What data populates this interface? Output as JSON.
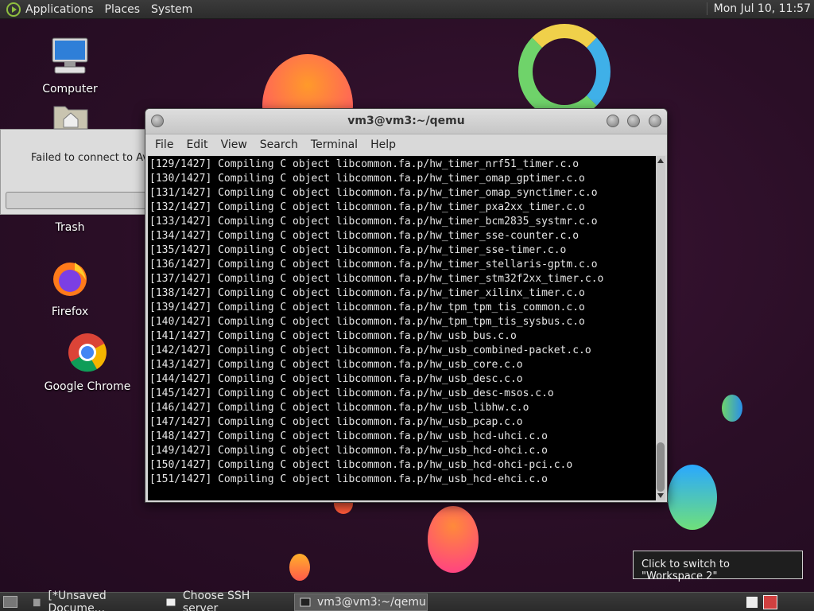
{
  "top_panel": {
    "menus": [
      "Applications",
      "Places",
      "System"
    ],
    "clock": "Mon Jul 10, 11:57"
  },
  "desktop_icons": [
    {
      "label": "Computer"
    },
    {
      "label": "Trash"
    },
    {
      "label": "Firefox"
    },
    {
      "label": "Google Chrome"
    }
  ],
  "failed_dialog": {
    "message": "Failed to connect to Ava"
  },
  "terminal": {
    "title": "vm3@vm3:~/qemu",
    "menu": [
      "File",
      "Edit",
      "View",
      "Search",
      "Terminal",
      "Help"
    ],
    "lines": [
      "[129/1427] Compiling C object libcommon.fa.p/hw_timer_nrf51_timer.c.o",
      "[130/1427] Compiling C object libcommon.fa.p/hw_timer_omap_gptimer.c.o",
      "[131/1427] Compiling C object libcommon.fa.p/hw_timer_omap_synctimer.c.o",
      "[132/1427] Compiling C object libcommon.fa.p/hw_timer_pxa2xx_timer.c.o",
      "[133/1427] Compiling C object libcommon.fa.p/hw_timer_bcm2835_systmr.c.o",
      "[134/1427] Compiling C object libcommon.fa.p/hw_timer_sse-counter.c.o",
      "[135/1427] Compiling C object libcommon.fa.p/hw_timer_sse-timer.c.o",
      "[136/1427] Compiling C object libcommon.fa.p/hw_timer_stellaris-gptm.c.o",
      "[137/1427] Compiling C object libcommon.fa.p/hw_timer_stm32f2xx_timer.c.o",
      "[138/1427] Compiling C object libcommon.fa.p/hw_timer_xilinx_timer.c.o",
      "[139/1427] Compiling C object libcommon.fa.p/hw_tpm_tpm_tis_common.c.o",
      "[140/1427] Compiling C object libcommon.fa.p/hw_tpm_tpm_tis_sysbus.c.o",
      "[141/1427] Compiling C object libcommon.fa.p/hw_usb_bus.c.o",
      "[142/1427] Compiling C object libcommon.fa.p/hw_usb_combined-packet.c.o",
      "[143/1427] Compiling C object libcommon.fa.p/hw_usb_core.c.o",
      "[144/1427] Compiling C object libcommon.fa.p/hw_usb_desc.c.o",
      "[145/1427] Compiling C object libcommon.fa.p/hw_usb_desc-msos.c.o",
      "[146/1427] Compiling C object libcommon.fa.p/hw_usb_libhw.c.o",
      "[147/1427] Compiling C object libcommon.fa.p/hw_usb_pcap.c.o",
      "[148/1427] Compiling C object libcommon.fa.p/hw_usb_hcd-uhci.c.o",
      "[149/1427] Compiling C object libcommon.fa.p/hw_usb_hcd-ohci.c.o",
      "[150/1427] Compiling C object libcommon.fa.p/hw_usb_hcd-ohci-pci.c.o",
      "[151/1427] Compiling C object libcommon.fa.p/hw_usb_hcd-ehci.c.o"
    ]
  },
  "tooltip": {
    "text": "Click to switch to \"Workspace 2\""
  },
  "taskbar": {
    "tasks": [
      {
        "label": "[*Unsaved Docume..."
      },
      {
        "label": "Choose SSH server"
      },
      {
        "label": "vm3@vm3:~/qemu"
      }
    ]
  },
  "colors": {
    "accent": "#8fbf3f",
    "terminal_bg": "#000000",
    "terminal_fg": "#e6e6e6"
  }
}
